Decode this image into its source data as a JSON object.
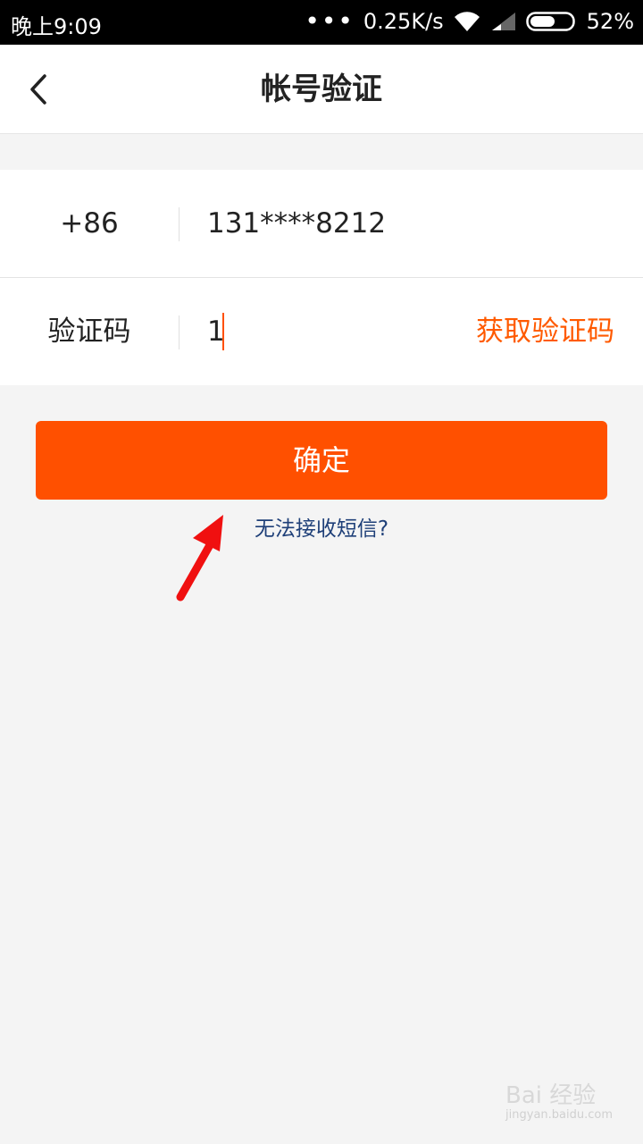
{
  "status_bar": {
    "time": "晚上9:09",
    "network_speed": "0.25K/s",
    "battery": "52%",
    "icons": [
      "wifi-icon",
      "signal-icon",
      "battery-icon"
    ]
  },
  "nav": {
    "back_icon": "chevron-left-icon",
    "title": "帐号验证"
  },
  "form": {
    "phone": {
      "country_code": "+86",
      "number": "131****8212"
    },
    "code": {
      "label": "验证码",
      "value": "1",
      "get_code_label": "获取验证码"
    }
  },
  "confirm_label": "确定",
  "no_sms_link": "无法接收短信?",
  "watermark": {
    "brand": "Bai 经验",
    "url": "jingyan.baidu.com"
  },
  "colors": {
    "accent": "#ff5000",
    "link": "#1e3f78",
    "background": "#f4f4f4"
  }
}
